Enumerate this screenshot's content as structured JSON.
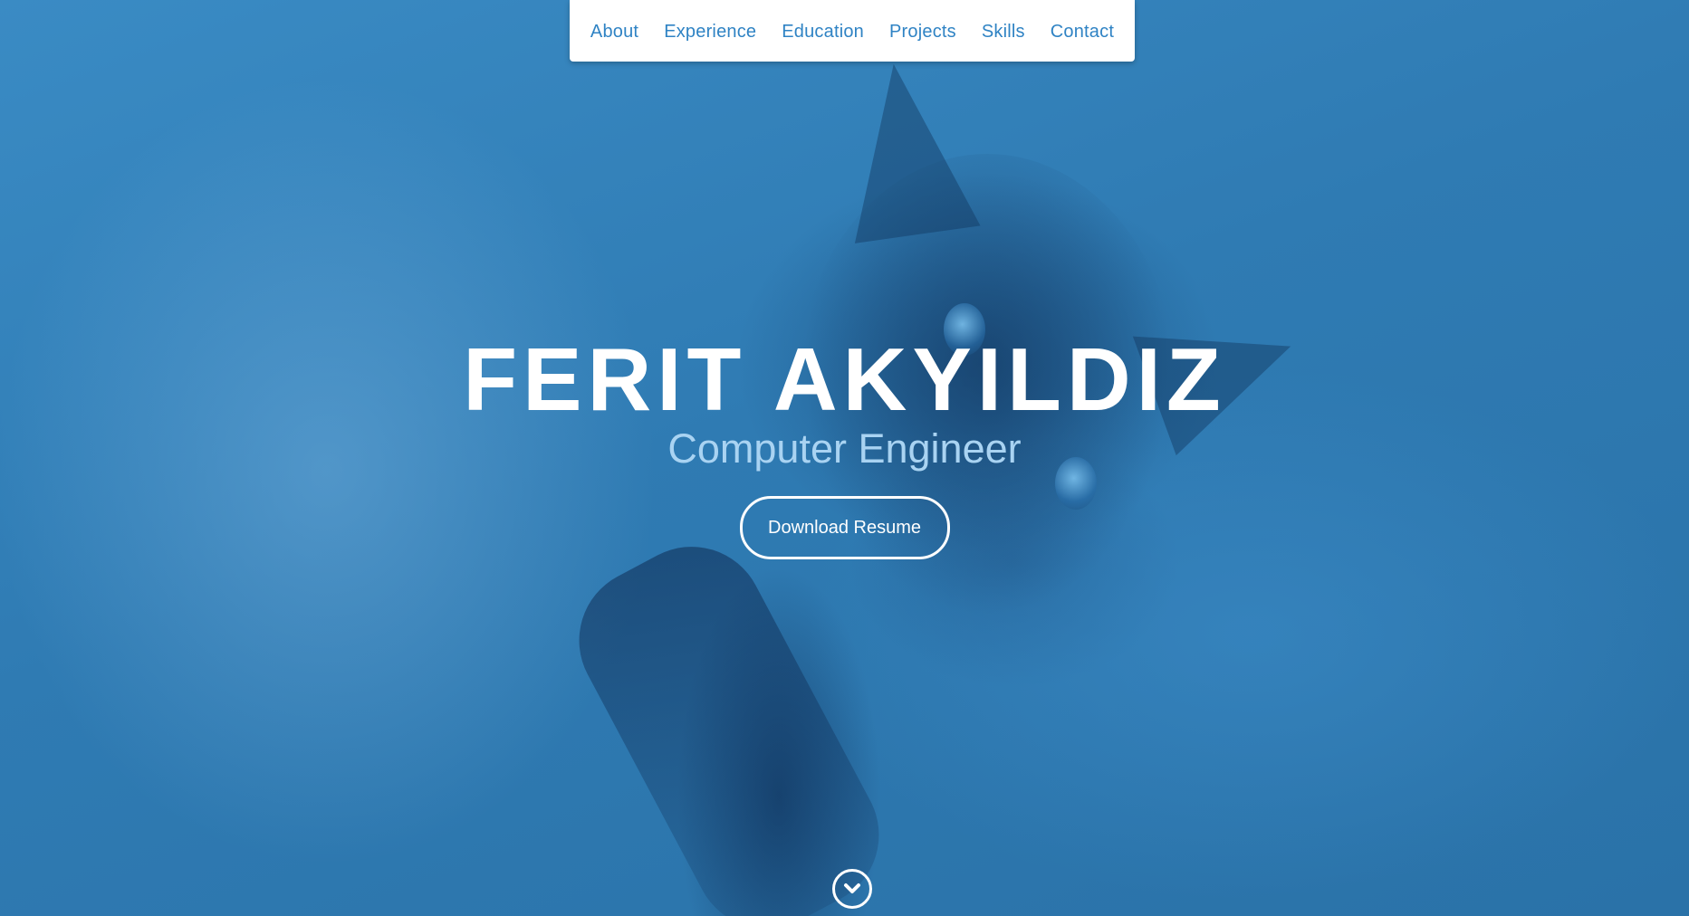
{
  "nav": {
    "items": [
      {
        "label": "About"
      },
      {
        "label": "Experience"
      },
      {
        "label": "Education"
      },
      {
        "label": "Projects"
      },
      {
        "label": "Skills"
      },
      {
        "label": "Contact"
      }
    ]
  },
  "hero": {
    "name": "FERIT AKYILDIZ",
    "subtitle": "Computer Engineer",
    "resume_button": "Download Resume",
    "scroll_icon": "chevron-down-icon"
  },
  "colors": {
    "accent": "#2f83c4",
    "overlay": "#2f7bb3",
    "subtitle": "#a9d3f2"
  }
}
